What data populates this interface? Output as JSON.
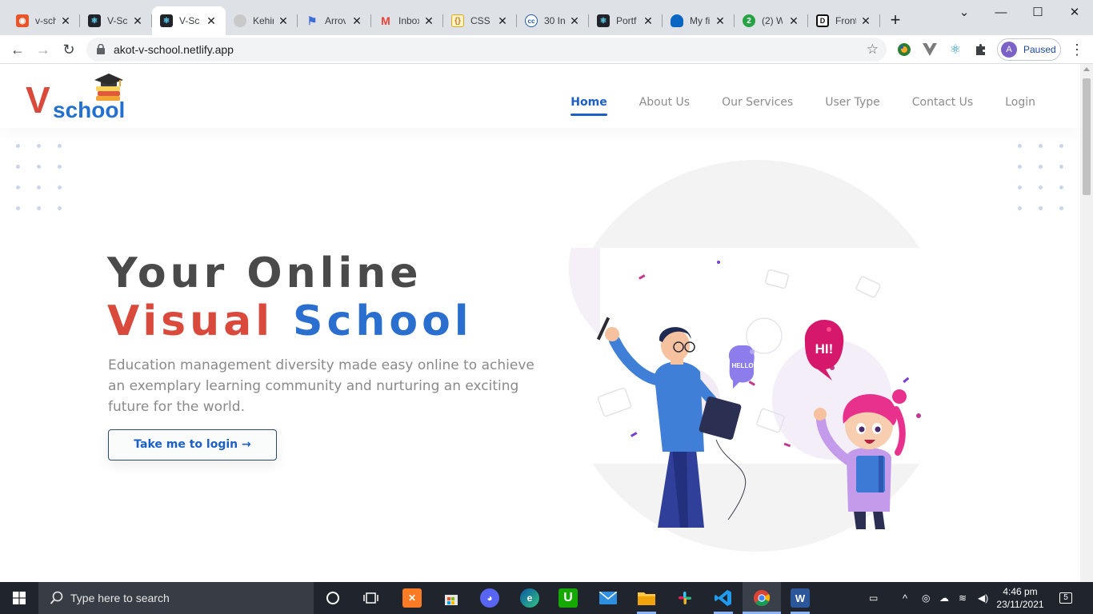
{
  "browser": {
    "tabs": [
      {
        "title": "v-sch",
        "icon": "rocket-tab-icon",
        "color": "#e8552a"
      },
      {
        "title": "V-Scl",
        "icon": "react-tab-icon",
        "color": "#20232a"
      },
      {
        "title": "V-Scl",
        "icon": "react-tab-icon",
        "color": "#20232a",
        "active": true
      },
      {
        "title": "Kehir",
        "icon": "github-tab-icon",
        "color": "#c9c9c9"
      },
      {
        "title": "Arrov",
        "icon": "flag-tab-icon",
        "color": "#3b6ed9"
      },
      {
        "title": "Inbox",
        "icon": "gmail-tab-icon",
        "color": "#ea4335"
      },
      {
        "title": "CSS (",
        "icon": "css-tab-icon",
        "color": "#f0a500"
      },
      {
        "title": "30 In",
        "icon": "cc-tab-icon",
        "color": "#1b5aa6"
      },
      {
        "title": "Portf",
        "icon": "react-tab-icon",
        "color": "#20232a"
      },
      {
        "title": "My fi",
        "icon": "onedrive-tab-icon",
        "color": "#0a66c2"
      },
      {
        "title": "(2) W",
        "icon": "whatsapp-tab-icon",
        "color": "#25a244"
      },
      {
        "title": "Front",
        "icon": "frontend-tab-icon",
        "color": "#111111"
      }
    ],
    "new_tab": "+",
    "address": "akot-v-school.netlify.app",
    "profile_initial": "A",
    "profile_status": "Paused"
  },
  "site": {
    "logo_v": "V",
    "logo_school": "school",
    "nav": [
      {
        "label": "Home",
        "active": true
      },
      {
        "label": "About Us"
      },
      {
        "label": "Our Services"
      },
      {
        "label": "User Type"
      },
      {
        "label": "Contact Us"
      },
      {
        "label": "Login"
      }
    ],
    "hero": {
      "line1": "Your Online",
      "word_visual": "Visual",
      "word_school": "School",
      "description": "Education management diversity made easy online to achieve an exemplary learning community and nurturing an exciting future for the world.",
      "cta": "Take me to login →"
    },
    "illustration": {
      "bubble_hello": "HELLO",
      "bubble_hi": "HI!"
    },
    "colors": {
      "brand_red": "#d94a3d",
      "brand_blue": "#2a6fcf",
      "nav_active": "#1b5fc7"
    }
  },
  "taskbar": {
    "search_placeholder": "Type here to search",
    "time": "4:46 pm",
    "date": "23/11/2021",
    "notification_count": "5",
    "apps": [
      "cortana-icon",
      "task-view-icon",
      "xampp-icon",
      "store-icon",
      "discord-icon",
      "edge-icon",
      "upwork-icon",
      "mail-icon",
      "file-explorer-icon",
      "slack-icon",
      "vscode-icon",
      "chrome-icon",
      "word-icon"
    ]
  }
}
